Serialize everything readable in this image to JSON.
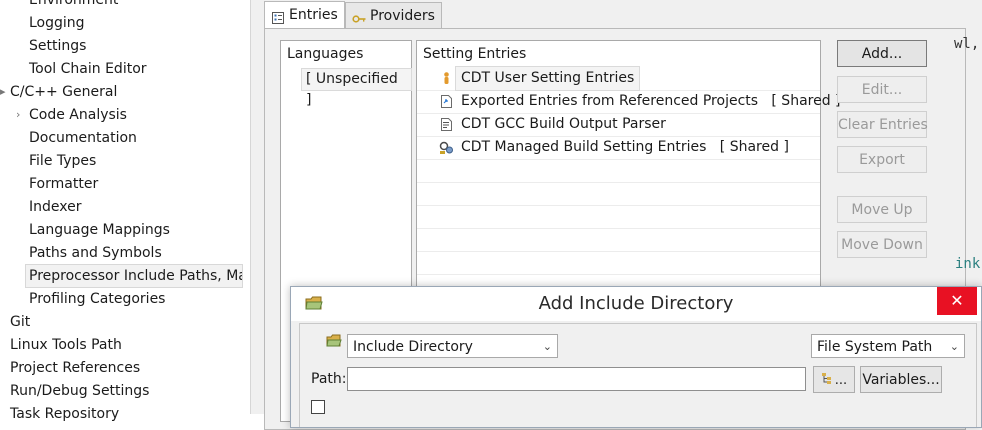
{
  "tree": {
    "items": [
      {
        "label": "Environment"
      },
      {
        "label": "Logging"
      },
      {
        "label": "Settings"
      },
      {
        "label": "Tool Chain Editor"
      },
      {
        "label": "C/C++ General"
      },
      {
        "label": "Code Analysis"
      },
      {
        "label": "Documentation"
      },
      {
        "label": "File Types"
      },
      {
        "label": "Formatter"
      },
      {
        "label": "Indexer"
      },
      {
        "label": "Language Mappings"
      },
      {
        "label": "Paths and Symbols"
      },
      {
        "label": "Preprocessor Include Paths, Mac"
      },
      {
        "label": "Profiling Categories"
      },
      {
        "label": "Git"
      },
      {
        "label": "Linux Tools Path"
      },
      {
        "label": "Project References"
      },
      {
        "label": "Run/Debug Settings"
      },
      {
        "label": "Task Repository"
      }
    ]
  },
  "tabs": [
    {
      "label": "Entries",
      "icon": "entries-icon"
    },
    {
      "label": "Providers",
      "icon": "key-icon"
    }
  ],
  "languages": {
    "header": "Languages",
    "items": [
      {
        "label": "[ Unspecified ]"
      }
    ]
  },
  "entries": {
    "header": "Setting Entries",
    "rows": [
      {
        "label": "CDT User Setting Entries",
        "icon": "user-icon"
      },
      {
        "label": "Exported Entries from Referenced Projects   [ Shared ]",
        "icon": "export-doc-icon"
      },
      {
        "label": "CDT GCC Build Output Parser",
        "icon": "parser-icon"
      },
      {
        "label": "CDT Managed Build Setting Entries   [ Shared ]",
        "icon": "managed-build-icon"
      }
    ]
  },
  "buttons": {
    "add": "Add...",
    "edit": "Edit...",
    "clear": "Clear Entries",
    "export": "Export",
    "move_up": "Move Up",
    "move_down": "Move Down"
  },
  "code_fragments": {
    "top": "wl,",
    "bottom": "ink"
  },
  "dialog": {
    "title": "Add Include Directory",
    "close_symbol": "✕",
    "kind_value": "Include Directory",
    "location_value": "File System Path",
    "path_label": "Path:",
    "path_value": "",
    "browse_label": "...",
    "variables_label": "Variables..."
  }
}
